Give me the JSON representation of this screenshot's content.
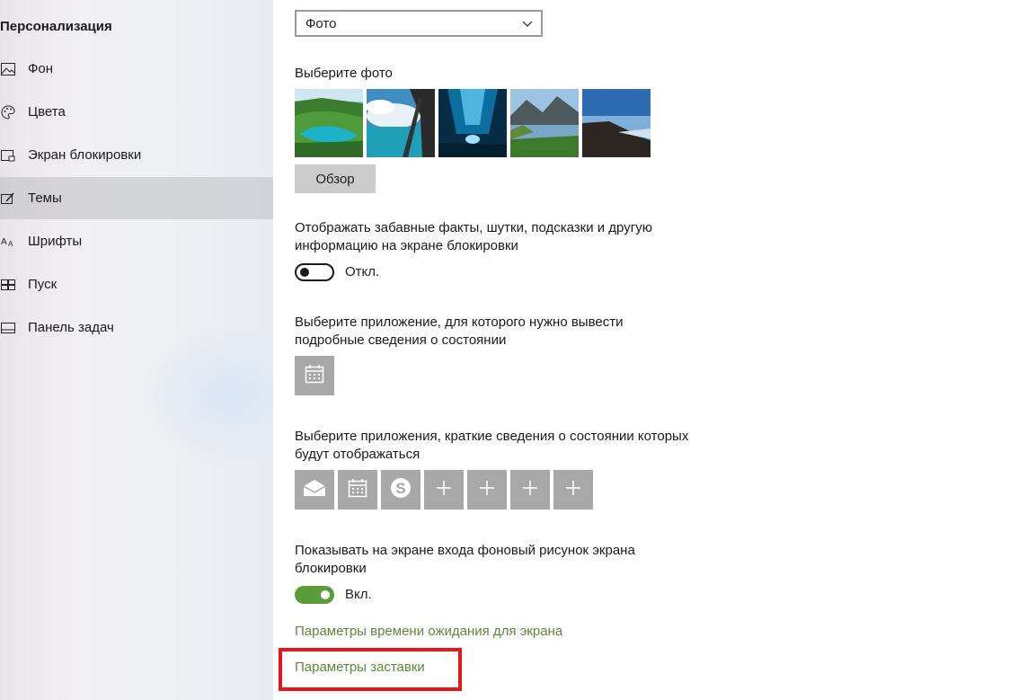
{
  "sidebar": {
    "title": "Персонализация",
    "items": [
      {
        "label": "Фон",
        "icon": "picture-icon"
      },
      {
        "label": "Цвета",
        "icon": "palette-icon"
      },
      {
        "label": "Экран блокировки",
        "icon": "lock-screen-icon"
      },
      {
        "label": "Темы",
        "icon": "themes-icon",
        "active": true
      },
      {
        "label": "Шрифты",
        "icon": "fonts-icon"
      },
      {
        "label": "Пуск",
        "icon": "start-icon"
      },
      {
        "label": "Панель задач",
        "icon": "taskbar-icon"
      }
    ]
  },
  "main": {
    "background_select": {
      "value": "Фото"
    },
    "choose_photo_label": "Выберите фото",
    "photos": [
      "lake-cliffs-photo",
      "ocean-arch-photo",
      "underwater-cave-photo",
      "mountain-lake-photo",
      "volcano-slope-photo"
    ],
    "browse_label": "Обзор",
    "fun_facts": {
      "label_line1": "Отображать забавные факты, шутки, подсказки и другую",
      "label_line2": "информацию на экране блокировки",
      "state": "Откл."
    },
    "detailed_status": {
      "label_line1": "Выберите приложение, для которого нужно вывести",
      "label_line2": "подробные сведения о состоянии",
      "app_icon": "calendar-icon"
    },
    "quick_status": {
      "label_line1": "Выберите приложения, краткие сведения о состоянии которых",
      "label_line2": "будут отображаться",
      "apps": [
        "mail-icon",
        "calendar-icon",
        "skype-icon",
        "plus-icon",
        "plus-icon",
        "plus-icon",
        "plus-icon"
      ]
    },
    "signin_background": {
      "label_line1": "Показывать на экране входа фоновый рисунок экрана",
      "label_line2": "блокировки",
      "state": "Вкл."
    },
    "links": {
      "screen_timeout": "Параметры времени ожидания для экрана",
      "screensaver": "Параметры заставки"
    }
  },
  "colors": {
    "accent": "#5b9b3a",
    "link": "#5b8a3a",
    "highlight": "#e8151b"
  }
}
